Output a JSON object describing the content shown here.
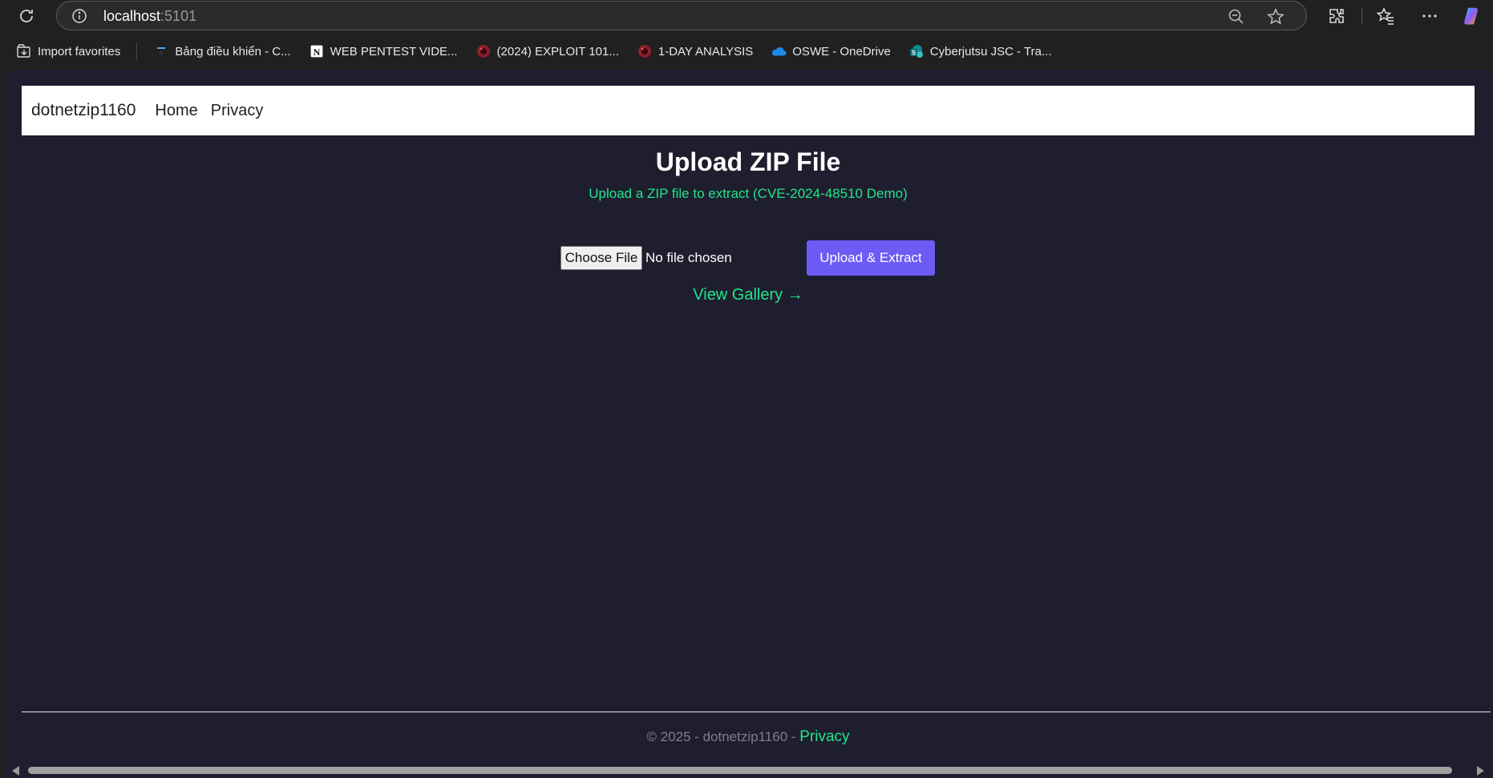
{
  "browser": {
    "url_host": "localhost",
    "url_port": ":5101",
    "bookmarks": [
      {
        "label": "Import favorites",
        "icon": "import-favorites-icon"
      },
      {
        "label": "Bảng điều khiển - C...",
        "icon": "dashboard-icon"
      },
      {
        "label": "WEB PENTEST VIDE...",
        "icon": "notion-icon"
      },
      {
        "label": "(2024) EXPLOIT 101...",
        "icon": "red-globe-icon"
      },
      {
        "label": "1-DAY ANALYSIS",
        "icon": "red-globe-icon"
      },
      {
        "label": "OSWE - OneDrive",
        "icon": "onedrive-icon"
      },
      {
        "label": "Cyberjutsu JSC - Tra...",
        "icon": "sharepoint-icon"
      }
    ]
  },
  "navbar": {
    "brand": "dotnetzip1160",
    "links": [
      "Home",
      "Privacy"
    ]
  },
  "main": {
    "title": "Upload ZIP File",
    "subtitle": "Upload a ZIP file to extract (CVE-2024-48510 Demo)",
    "choose_file_label": "Choose File",
    "no_file_text": "No file chosen",
    "upload_button": "Upload & Extract",
    "gallery_link": "View Gallery →"
  },
  "footer": {
    "copyright": "© 2025 - dotnetzip1160 - ",
    "privacy_link": "Privacy"
  },
  "colors": {
    "page_bg": "#1e1e2f",
    "accent_green": "#22e58a",
    "button_purple": "#6c5bf5"
  }
}
